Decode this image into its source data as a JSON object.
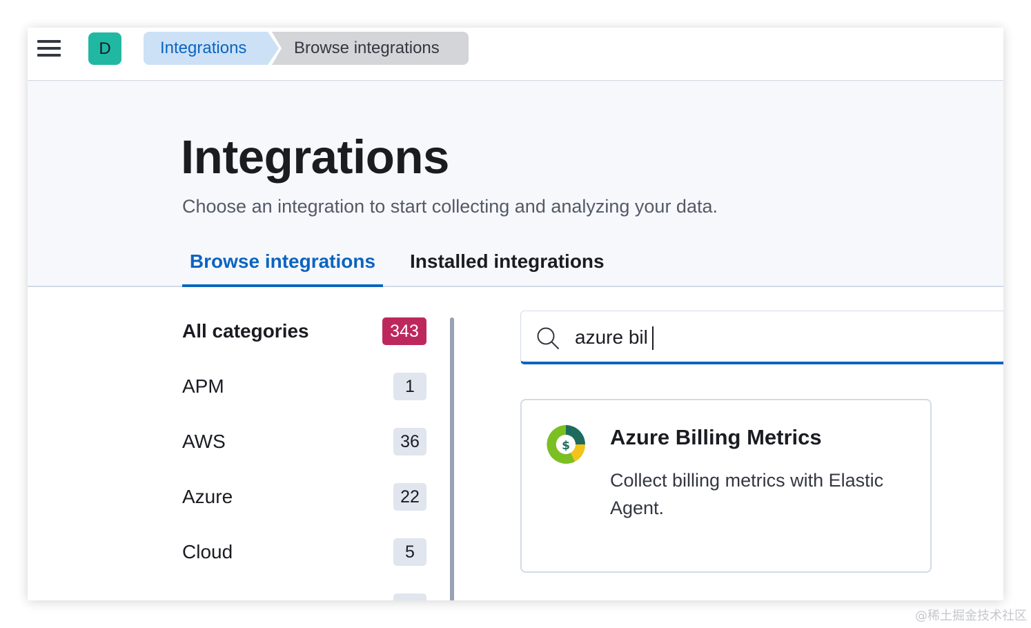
{
  "header": {
    "avatar_letter": "D",
    "breadcrumbs": [
      {
        "label": "Integrations"
      },
      {
        "label": "Browse integrations"
      }
    ]
  },
  "page": {
    "title": "Integrations",
    "subtitle": "Choose an integration to start collecting and analyzing your data."
  },
  "tabs": [
    {
      "label": "Browse integrations",
      "selected": true
    },
    {
      "label": "Installed integrations",
      "selected": false
    }
  ],
  "categories": [
    {
      "label": "All categories",
      "count": "343"
    },
    {
      "label": "APM",
      "count": "1"
    },
    {
      "label": "AWS",
      "count": "36"
    },
    {
      "label": "Azure",
      "count": "22"
    },
    {
      "label": "Cloud",
      "count": "5"
    }
  ],
  "search": {
    "value": "azure bil",
    "icon": "search-icon"
  },
  "results": [
    {
      "title": "Azure Billing Metrics",
      "description": "Collect billing metrics with Elastic Agent.",
      "icon": "azure-billing-logo-icon"
    }
  ],
  "colors": {
    "accent": "#0b64c0",
    "badge_accent": "#bd285c",
    "avatar": "#20b8a3"
  },
  "watermark": "@稀土掘金技术社区"
}
